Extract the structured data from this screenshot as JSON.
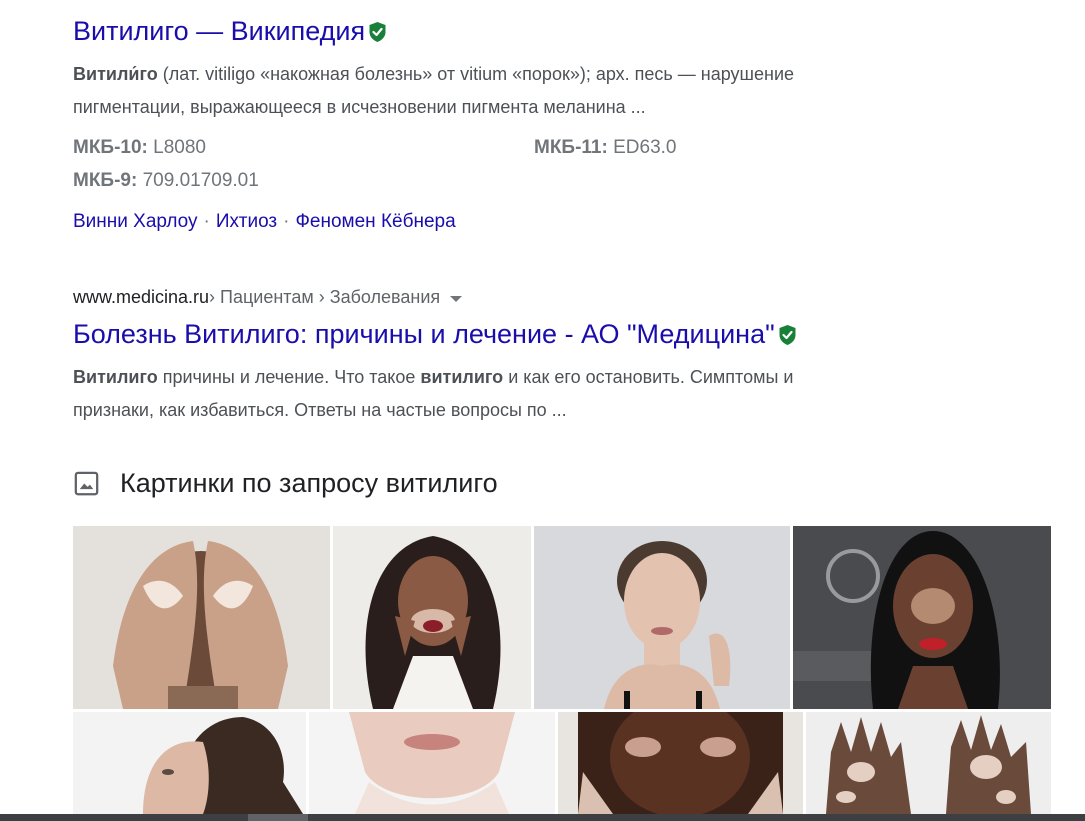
{
  "wiki": {
    "title": "Витилиго — Википедия",
    "snippet_bold": "Витили́го",
    "snippet_line1_rest": " (лат. vitiligo «накожная болезнь» от vitium «порок»); арх. песь — нарушение",
    "snippet_line2": "пигментации, выражающееся в исчезновении пигмента меланина ...",
    "facts": [
      {
        "label": "МКБ-10:",
        "value": " L8080"
      },
      {
        "label": "МКБ-11:",
        "value": " ED63.0"
      },
      {
        "label": "МКБ-9:",
        "value": " 709.01709.01"
      }
    ],
    "sitelinks": [
      "Винни Харлоу",
      "Ихтиоз",
      "Феномен Кёбнера"
    ],
    "sitelink_sep": "·"
  },
  "medicina": {
    "domain": "www.medicina.ru",
    "path": " › Пациентам › Заболевания",
    "title": "Болезнь Витилиго: причины и лечение - АО \"Медицина\"",
    "s1_b1": "Витилиго",
    "s1_t1": " причины и лечение. Что такое ",
    "s1_b2": "витилиго",
    "s1_t2": " и как его остановить. Симптомы и",
    "s2": "признаки, как избавиться. Ответы на частые вопросы по ..."
  },
  "images": {
    "header": "Картинки по запросу витилиго",
    "icon": "image-icon",
    "tiles": [
      {
        "name": "image-hands-over-face",
        "bg": "#d9d6d2"
      },
      {
        "name": "image-woman-dark-hair",
        "bg": "#e8e6e3"
      },
      {
        "name": "image-woman-short-hair",
        "bg": "#d5d6d9"
      },
      {
        "name": "image-woman-festival",
        "bg": "#3a3a3c"
      },
      {
        "name": "image-woman-ponytail",
        "bg": "#f2f2f2"
      },
      {
        "name": "image-lips-closeup",
        "bg": "#ece5e0"
      },
      {
        "name": "image-face-hands",
        "bg": "#e6e2df"
      },
      {
        "name": "image-hands-spots",
        "bg": "#ebebeb"
      }
    ]
  },
  "colors": {
    "link": "#1a0dab",
    "snippet": "#4d5156",
    "verified": "#188038"
  }
}
